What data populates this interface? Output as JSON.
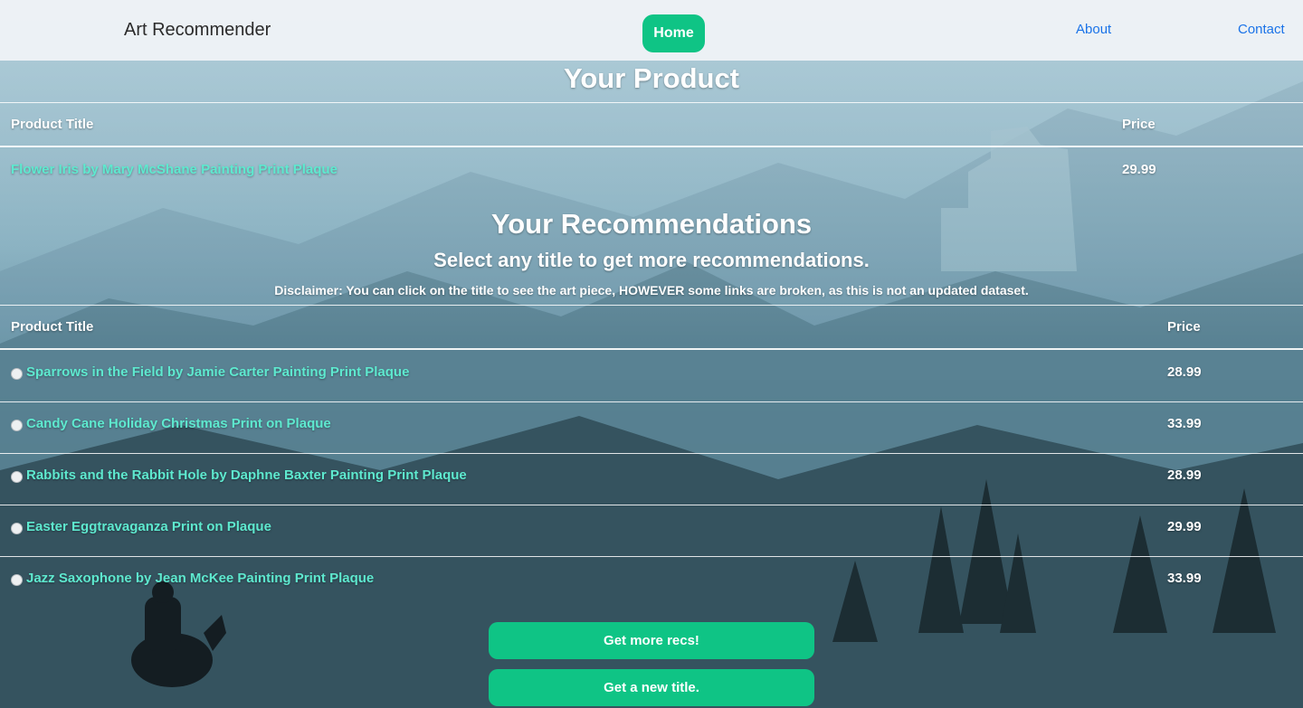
{
  "navbar": {
    "brand": "Art Recommender",
    "home_label": "Home",
    "about_label": "About",
    "contact_label": "Contact"
  },
  "product_section": {
    "heading": "Your Product",
    "col_title": "Product Title",
    "col_price": "Price",
    "product": {
      "title": "Flower Iris by Mary McShane Painting Print Plaque",
      "price": "29.99"
    }
  },
  "recs_section": {
    "heading": "Your Recommendations",
    "subheading": "Select any title to get more recommendations.",
    "disclaimer": "Disclaimer: You can click on the title to see the art piece, HOWEVER some links are broken, as this is not an updated dataset.",
    "col_title": "Product Title",
    "col_price": "Price",
    "rows": [
      {
        "title": "Sparrows in the Field by Jamie Carter Painting Print Plaque",
        "price": "28.99"
      },
      {
        "title": "Candy Cane Holiday Christmas Print on Plaque",
        "price": "33.99"
      },
      {
        "title": "Rabbits and the Rabbit Hole by Daphne Baxter Painting Print Plaque",
        "price": "28.99"
      },
      {
        "title": "Easter Eggtravaganza Print on Plaque",
        "price": "29.99"
      },
      {
        "title": "Jazz Saxophone by Jean McKee Painting Print Plaque",
        "price": "33.99"
      }
    ]
  },
  "buttons": {
    "more_recs": "Get more recs!",
    "new_title": "Get a new title."
  },
  "colors": {
    "accent": "#0fc485",
    "link": "#5ee9cf",
    "nav_link": "#1a73e8"
  }
}
